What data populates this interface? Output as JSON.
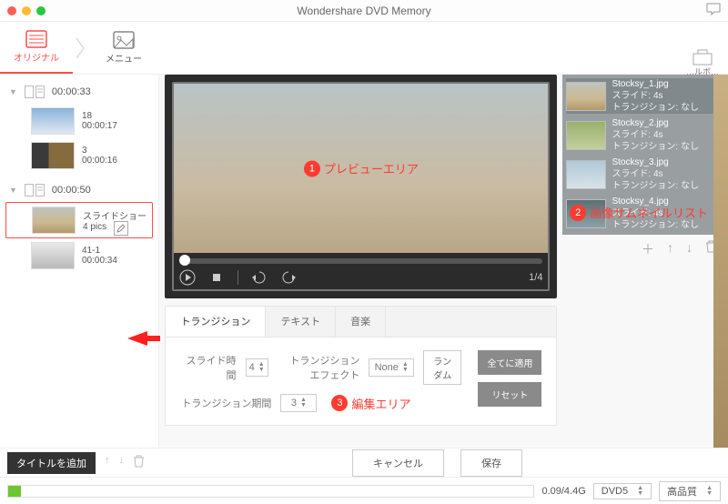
{
  "window": {
    "title": "Wondershare DVD Memory"
  },
  "top_tabs": {
    "original": "オリジナル",
    "menu": "メニュー",
    "toolbox_sliver": "…ルボ…"
  },
  "sidebar": {
    "group1": {
      "time": "00:00:33"
    },
    "group2": {
      "time": "00:00:50"
    },
    "clips": [
      {
        "title": "18",
        "time": "00:00:17"
      },
      {
        "title": "3",
        "time": "00:00:16"
      },
      {
        "title": "スライドショー",
        "time": "4 pics"
      },
      {
        "title": "41-1",
        "time": "00:00:34"
      }
    ],
    "add_title_label": "タイトルを追加"
  },
  "preview": {
    "counter": "1/4"
  },
  "thumbs": {
    "items": [
      {
        "file": "Stocksy_1.jpg",
        "slide": "スライド: 4s",
        "trans": "トランジション: なし"
      },
      {
        "file": "Stocksy_2.jpg",
        "slide": "スライド: 4s",
        "trans": "トランジション: なし"
      },
      {
        "file": "Stocksy_3.jpg",
        "slide": "スライド: 4s",
        "trans": "トランジション: なし"
      },
      {
        "file": "Stocksy_4.jpg",
        "slide": "スライド: 4s",
        "trans": "トランジション: なし"
      }
    ]
  },
  "editor": {
    "tabs": {
      "transition": "トランジション",
      "text": "テキスト",
      "music": "音楽"
    },
    "slide_time_label": "スライド時間",
    "slide_time_value": "4",
    "trans_time_label": "トランジション期間",
    "trans_time_value": "3",
    "effect_label": "トランジションエフェクト",
    "effect_value": "None",
    "random_label": "ランダム",
    "apply_all_label": "全てに適用",
    "reset_label": "リセット"
  },
  "annotations": {
    "a1": "プレビューエリア",
    "a2": "画像サムネイルリスト",
    "a3": "編集エリア"
  },
  "bottom": {
    "cancel": "キャンセル",
    "save": "保存"
  },
  "status": {
    "size": "0.09/4.4G",
    "disc": "DVD5",
    "quality": "高品質"
  }
}
